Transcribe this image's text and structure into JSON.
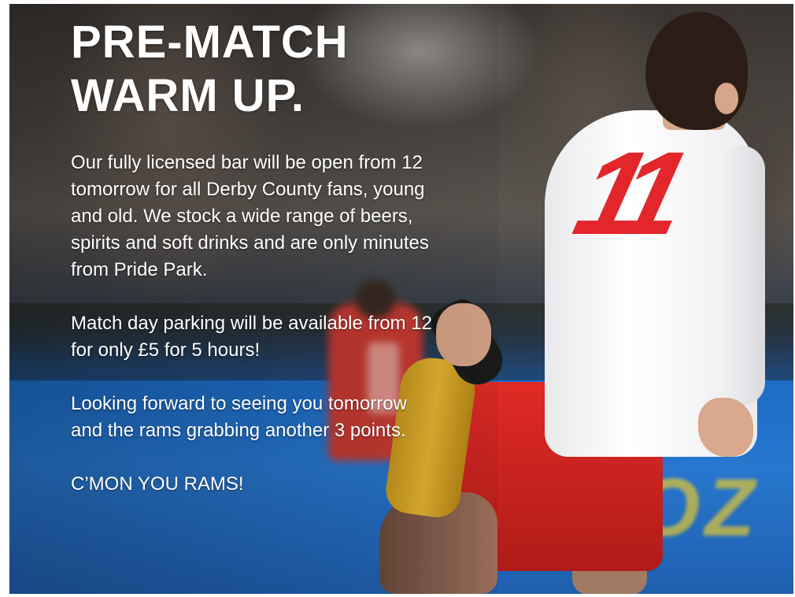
{
  "poster": {
    "title_line1": "PRE-MATCH",
    "title_line2": "WARM UP.",
    "paragraphs": [
      "Our fully licensed bar will be open from 12 tomorrow for all Derby County fans, young and old. We stock a wide range of beers, spirits and soft drinks and are only minutes from Pride Park.",
      "Match day parking will be available from 12 for only £5 for 5 hours!",
      "Looking forward to seeing you tomorrow and the rams grabbing another 3 points."
    ],
    "closing": "C’MON YOU RAMS!"
  },
  "photo": {
    "shirt_number": "11",
    "hoarding_text": "ECOZ"
  },
  "colors": {
    "text": "#ffffff",
    "shirt_number": "#e2262b",
    "hoarding": "#1c6cc6",
    "shorts": "#e02a25",
    "sock": "#e4b530"
  }
}
